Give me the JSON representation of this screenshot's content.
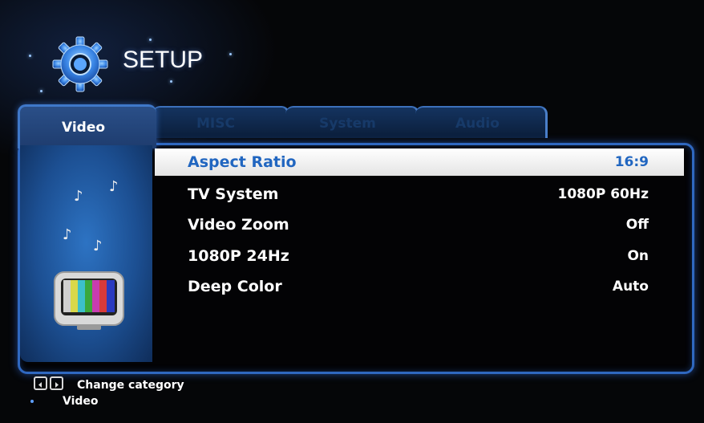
{
  "header": {
    "title": "SETUP",
    "icon": "gear-icon"
  },
  "tabs": [
    {
      "label": "Video",
      "active": true
    },
    {
      "label": "MISC",
      "active": false
    },
    {
      "label": "System",
      "active": false
    },
    {
      "label": "Audio",
      "active": false
    }
  ],
  "settings": [
    {
      "label": "Aspect Ratio",
      "value": "16:9",
      "selected": true
    },
    {
      "label": "TV System",
      "value": "1080P 60Hz",
      "selected": false
    },
    {
      "label": "Video Zoom",
      "value": "Off",
      "selected": false
    },
    {
      "label": "1080P 24Hz",
      "value": "On",
      "selected": false
    },
    {
      "label": "Deep Color",
      "value": "Auto",
      "selected": false
    }
  ],
  "sidebar": {
    "icons": [
      "music-note-icon",
      "tv-color-bars-icon"
    ]
  },
  "footer": {
    "hint": "Change category",
    "category": "Video",
    "keys": [
      "left-arrow-key-icon",
      "right-arrow-key-icon"
    ]
  },
  "colors": {
    "accent": "#2f68c0",
    "selected_text": "#2166c0",
    "selected_bg": "#ffffff"
  }
}
